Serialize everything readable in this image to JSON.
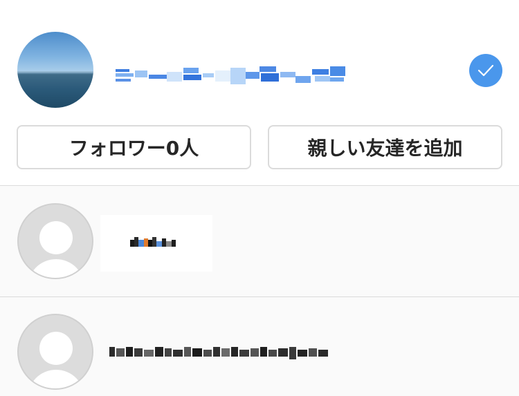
{
  "header": {
    "followers_button_label": "フォロワー0人",
    "close_friends_button_label": "親しい友達を追加"
  },
  "colors": {
    "accent": "#4a97ec",
    "background": "#ffffff",
    "list_background": "#fafafa",
    "border": "#dbdbdb"
  },
  "icons": {
    "verified": "checkmark-icon",
    "avatar_placeholder": "user-silhouette-icon"
  }
}
